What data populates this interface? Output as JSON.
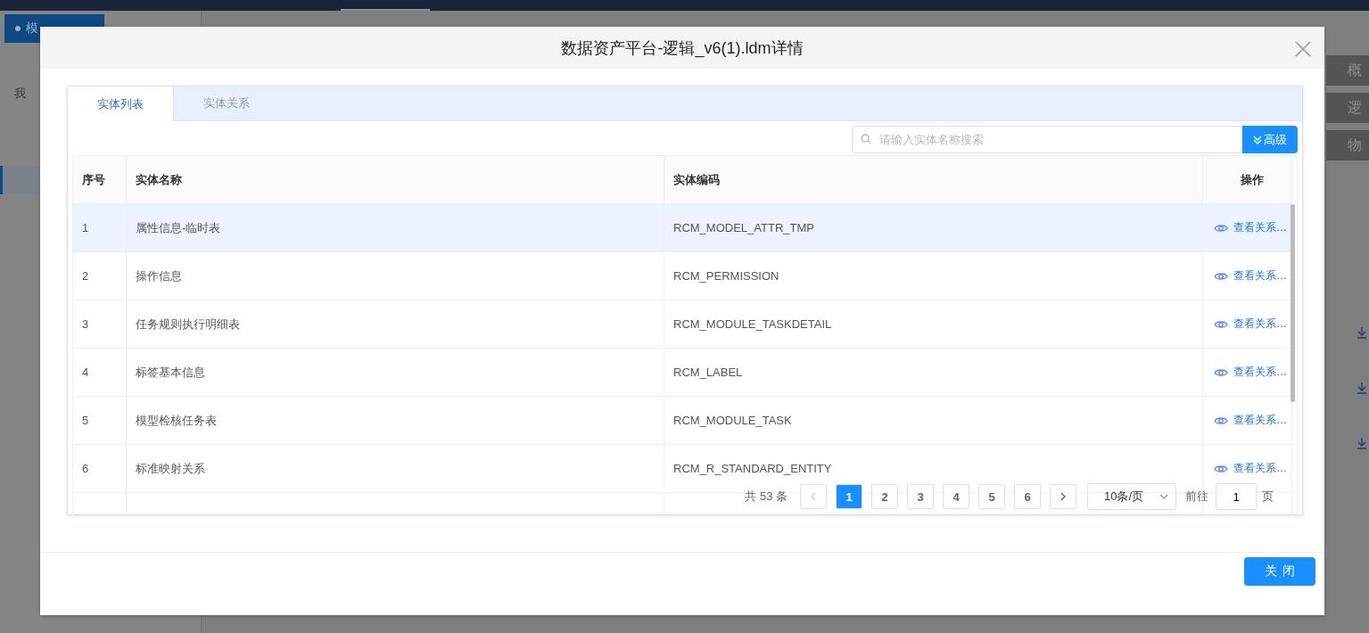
{
  "background": {
    "tab": "模",
    "tree_item": "我",
    "side_buttons": [
      "概",
      "逻",
      "物"
    ]
  },
  "dialog": {
    "title": "数据资产平台-逻辑_v6(1).ldm详情",
    "tabs": [
      {
        "label": "实体列表",
        "selected": true
      },
      {
        "label": "实体关系",
        "selected": false
      }
    ],
    "search": {
      "placeholder": "请输入实体名称搜索"
    },
    "advanced_button": "高级",
    "table": {
      "columns": [
        "序号",
        "实体名称",
        "实体编码",
        "操作"
      ],
      "rows": [
        {
          "index": "1",
          "name": "属性信息-临时表",
          "code": "RCM_MODEL_ATTR_TMP",
          "action": "查看关系…",
          "selected": true
        },
        {
          "index": "2",
          "name": "操作信息",
          "code": "RCM_PERMISSION",
          "action": "查看关系…",
          "selected": false
        },
        {
          "index": "3",
          "name": "任务规则执行明细表",
          "code": "RCM_MODULE_TASKDETAIL",
          "action": "查看关系…",
          "selected": false
        },
        {
          "index": "4",
          "name": "标签基本信息",
          "code": "RCM_LABEL",
          "action": "查看关系…",
          "selected": false
        },
        {
          "index": "5",
          "name": "模型检核任务表",
          "code": "RCM_MODULE_TASK",
          "action": "查看关系…",
          "selected": false
        },
        {
          "index": "6",
          "name": "标准映射关系",
          "code": "RCM_R_STANDARD_ENTITY",
          "action": "查看关系…",
          "selected": false
        }
      ]
    },
    "pagination": {
      "total": "共 53 条",
      "pages": [
        {
          "label": "1",
          "selected": true
        },
        {
          "label": "2",
          "selected": false
        },
        {
          "label": "3",
          "selected": false
        },
        {
          "label": "4",
          "selected": false
        },
        {
          "label": "5",
          "selected": false
        },
        {
          "label": "6",
          "selected": false
        }
      ],
      "page_size": "10条/页",
      "goto_label": "前往",
      "goto_value": "1",
      "page_unit": "页"
    },
    "close_button": "关闭"
  }
}
